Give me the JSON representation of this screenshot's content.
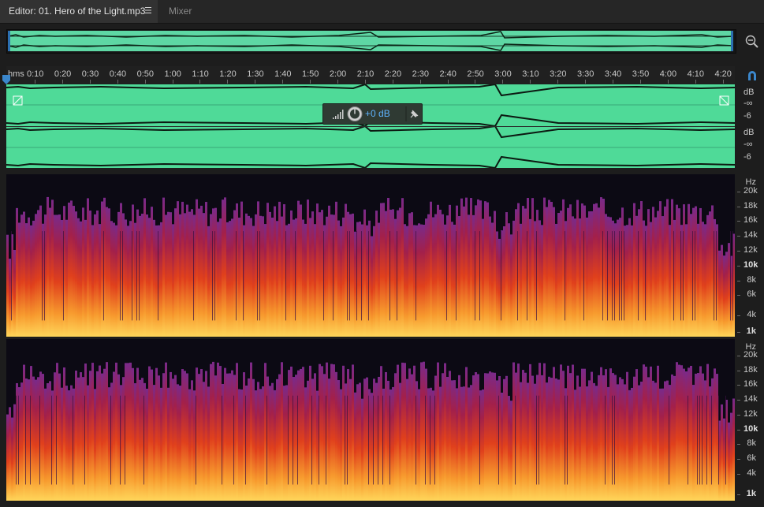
{
  "tabs": {
    "editor_label": "Editor: 01. Hero of the Light.mp3",
    "menu_glyph": "☰",
    "mixer_label": "Mixer"
  },
  "icons": {
    "zoom": "zoom-out-magnifier-icon",
    "snap": "magnet-snap-icon",
    "playhead": "playhead-marker-icon",
    "pin": "pin-icon",
    "fader": "fader-icon",
    "knob": "volume-knob-icon"
  },
  "colors": {
    "waveform": "#4fda98",
    "overview": "#5ed7a4",
    "spectral_low": "#ffd65a",
    "spectral_mid": "#e0401c",
    "spectral_high": "#7a2a8a"
  },
  "ruler": {
    "unit": "hms",
    "ticks": [
      "0:10",
      "0:20",
      "0:30",
      "0:40",
      "0:50",
      "1:00",
      "1:10",
      "1:20",
      "1:30",
      "1:40",
      "1:50",
      "2:00",
      "2:10",
      "2:20",
      "2:30",
      "2:40",
      "2:50",
      "3:00",
      "3:10",
      "3:20",
      "3:30",
      "3:40",
      "3:50",
      "4:00",
      "4:10",
      "4:20"
    ]
  },
  "hud": {
    "volume": "+0 dB"
  },
  "channels": [
    {
      "db_unit": "dB",
      "db_inf": "-∞",
      "db_6": "-6"
    },
    {
      "db_unit": "dB",
      "db_inf": "-∞",
      "db_6": "-6"
    }
  ],
  "spectral_scale": {
    "unit": "Hz",
    "labels": [
      "20k",
      "18k",
      "16k",
      "14k",
      "12k",
      "10k",
      "8k",
      "6k",
      "4k",
      "1k"
    ]
  }
}
